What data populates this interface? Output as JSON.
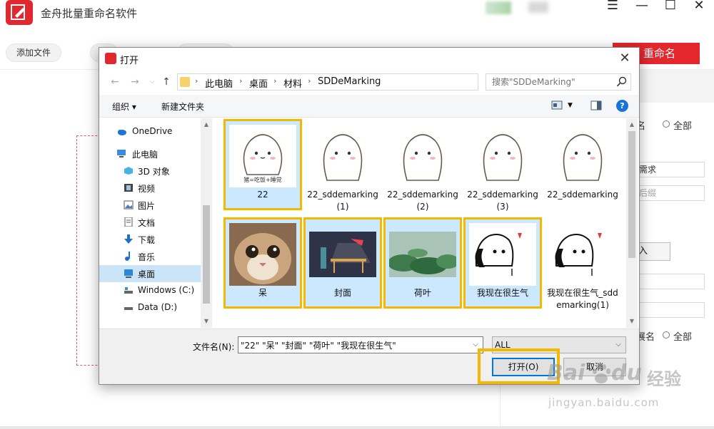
{
  "app": {
    "title": "金舟批量重命名软件",
    "add_file_label": "添加文件",
    "rename_label": "重命名",
    "accent": "#e4262d",
    "right_panel": {
      "radio1_label": "名",
      "radio1_all": "全部",
      "input1_value": "需求",
      "input2_placeholder": "后缀",
      "button_label": "入",
      "radio2_label": "展名",
      "radio2_all": "全部"
    }
  },
  "dialog": {
    "title": "打开",
    "close_glyph": "✕",
    "breadcrumbs": [
      "此电脑",
      "桌面",
      "材料",
      "SDDeMarking"
    ],
    "search_placeholder": "搜索\"SDDeMarking\"",
    "toolbar": {
      "organize_label": "组织 ▾",
      "new_folder_label": "新建文件夹",
      "help_label": "?"
    },
    "nav_items": [
      {
        "label": "OneDrive",
        "icon": "cloud-icon"
      },
      {
        "label": "此电脑",
        "icon": "computer-icon"
      },
      {
        "label": "3D 对象",
        "icon": "cube-icon"
      },
      {
        "label": "视频",
        "icon": "video-icon"
      },
      {
        "label": "图片",
        "icon": "picture-icon"
      },
      {
        "label": "文档",
        "icon": "document-icon"
      },
      {
        "label": "下载",
        "icon": "download-icon"
      },
      {
        "label": "音乐",
        "icon": "music-icon"
      },
      {
        "label": "桌面",
        "icon": "desktop-icon",
        "selected": true
      },
      {
        "label": "Windows (C:)",
        "icon": "drive-icon"
      },
      {
        "label": "Data (D:)",
        "icon": "drive-icon"
      }
    ],
    "files": [
      {
        "label": "22",
        "selected": true,
        "caption": "猪=吃饭+睡觉"
      },
      {
        "label": "22_sddemarking(1)",
        "selected": false
      },
      {
        "label": "22_sddemarking(2)",
        "selected": false
      },
      {
        "label": "22_sddemarking(3)",
        "selected": false
      },
      {
        "label": "22_sddemarking",
        "selected": false
      },
      {
        "label": "呆",
        "selected": true
      },
      {
        "label": "封面",
        "selected": true
      },
      {
        "label": "荷叶",
        "selected": true
      },
      {
        "label": "我现在很生气",
        "selected": true
      },
      {
        "label": "我现在很生气_sddemarking(1)",
        "selected": false
      }
    ],
    "filename_label": "文件名(N):",
    "filename_value": "\"22\" \"呆\" \"封面\" \"荷叶\" \"我现在很生气\"",
    "filetype_value": "ALL",
    "open_label": "打开(O)",
    "cancel_label": "取消",
    "highlight_color": "#f5b800",
    "selection_color": "#cce8ff"
  },
  "watermark": {
    "brand_a": "Bai",
    "brand_b": "du",
    "brand_cn": "经验",
    "url": "jingyan.baidu.com"
  }
}
